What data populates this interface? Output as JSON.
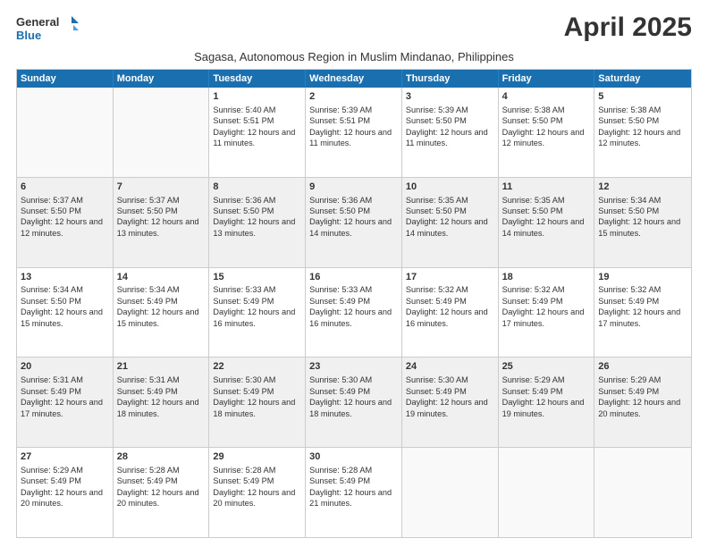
{
  "logo": {
    "line1": "General",
    "line2": "Blue"
  },
  "title": "April 2025",
  "subtitle": "Sagasa, Autonomous Region in Muslim Mindanao, Philippines",
  "weekdays": [
    "Sunday",
    "Monday",
    "Tuesday",
    "Wednesday",
    "Thursday",
    "Friday",
    "Saturday"
  ],
  "rows": [
    [
      {
        "day": "",
        "info": ""
      },
      {
        "day": "",
        "info": ""
      },
      {
        "day": "1",
        "info": "Sunrise: 5:40 AM\nSunset: 5:51 PM\nDaylight: 12 hours and 11 minutes."
      },
      {
        "day": "2",
        "info": "Sunrise: 5:39 AM\nSunset: 5:51 PM\nDaylight: 12 hours and 11 minutes."
      },
      {
        "day": "3",
        "info": "Sunrise: 5:39 AM\nSunset: 5:50 PM\nDaylight: 12 hours and 11 minutes."
      },
      {
        "day": "4",
        "info": "Sunrise: 5:38 AM\nSunset: 5:50 PM\nDaylight: 12 hours and 12 minutes."
      },
      {
        "day": "5",
        "info": "Sunrise: 5:38 AM\nSunset: 5:50 PM\nDaylight: 12 hours and 12 minutes."
      }
    ],
    [
      {
        "day": "6",
        "info": "Sunrise: 5:37 AM\nSunset: 5:50 PM\nDaylight: 12 hours and 12 minutes."
      },
      {
        "day": "7",
        "info": "Sunrise: 5:37 AM\nSunset: 5:50 PM\nDaylight: 12 hours and 13 minutes."
      },
      {
        "day": "8",
        "info": "Sunrise: 5:36 AM\nSunset: 5:50 PM\nDaylight: 12 hours and 13 minutes."
      },
      {
        "day": "9",
        "info": "Sunrise: 5:36 AM\nSunset: 5:50 PM\nDaylight: 12 hours and 14 minutes."
      },
      {
        "day": "10",
        "info": "Sunrise: 5:35 AM\nSunset: 5:50 PM\nDaylight: 12 hours and 14 minutes."
      },
      {
        "day": "11",
        "info": "Sunrise: 5:35 AM\nSunset: 5:50 PM\nDaylight: 12 hours and 14 minutes."
      },
      {
        "day": "12",
        "info": "Sunrise: 5:34 AM\nSunset: 5:50 PM\nDaylight: 12 hours and 15 minutes."
      }
    ],
    [
      {
        "day": "13",
        "info": "Sunrise: 5:34 AM\nSunset: 5:50 PM\nDaylight: 12 hours and 15 minutes."
      },
      {
        "day": "14",
        "info": "Sunrise: 5:34 AM\nSunset: 5:49 PM\nDaylight: 12 hours and 15 minutes."
      },
      {
        "day": "15",
        "info": "Sunrise: 5:33 AM\nSunset: 5:49 PM\nDaylight: 12 hours and 16 minutes."
      },
      {
        "day": "16",
        "info": "Sunrise: 5:33 AM\nSunset: 5:49 PM\nDaylight: 12 hours and 16 minutes."
      },
      {
        "day": "17",
        "info": "Sunrise: 5:32 AM\nSunset: 5:49 PM\nDaylight: 12 hours and 16 minutes."
      },
      {
        "day": "18",
        "info": "Sunrise: 5:32 AM\nSunset: 5:49 PM\nDaylight: 12 hours and 17 minutes."
      },
      {
        "day": "19",
        "info": "Sunrise: 5:32 AM\nSunset: 5:49 PM\nDaylight: 12 hours and 17 minutes."
      }
    ],
    [
      {
        "day": "20",
        "info": "Sunrise: 5:31 AM\nSunset: 5:49 PM\nDaylight: 12 hours and 17 minutes."
      },
      {
        "day": "21",
        "info": "Sunrise: 5:31 AM\nSunset: 5:49 PM\nDaylight: 12 hours and 18 minutes."
      },
      {
        "day": "22",
        "info": "Sunrise: 5:30 AM\nSunset: 5:49 PM\nDaylight: 12 hours and 18 minutes."
      },
      {
        "day": "23",
        "info": "Sunrise: 5:30 AM\nSunset: 5:49 PM\nDaylight: 12 hours and 18 minutes."
      },
      {
        "day": "24",
        "info": "Sunrise: 5:30 AM\nSunset: 5:49 PM\nDaylight: 12 hours and 19 minutes."
      },
      {
        "day": "25",
        "info": "Sunrise: 5:29 AM\nSunset: 5:49 PM\nDaylight: 12 hours and 19 minutes."
      },
      {
        "day": "26",
        "info": "Sunrise: 5:29 AM\nSunset: 5:49 PM\nDaylight: 12 hours and 20 minutes."
      }
    ],
    [
      {
        "day": "27",
        "info": "Sunrise: 5:29 AM\nSunset: 5:49 PM\nDaylight: 12 hours and 20 minutes."
      },
      {
        "day": "28",
        "info": "Sunrise: 5:28 AM\nSunset: 5:49 PM\nDaylight: 12 hours and 20 minutes."
      },
      {
        "day": "29",
        "info": "Sunrise: 5:28 AM\nSunset: 5:49 PM\nDaylight: 12 hours and 20 minutes."
      },
      {
        "day": "30",
        "info": "Sunrise: 5:28 AM\nSunset: 5:49 PM\nDaylight: 12 hours and 21 minutes."
      },
      {
        "day": "",
        "info": ""
      },
      {
        "day": "",
        "info": ""
      },
      {
        "day": "",
        "info": ""
      }
    ]
  ]
}
